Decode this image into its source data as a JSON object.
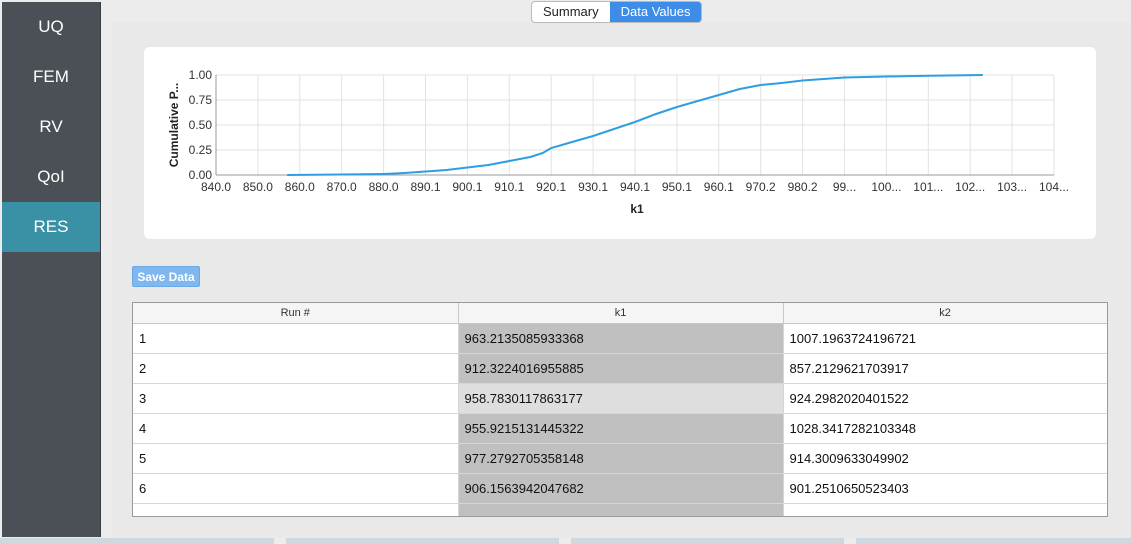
{
  "sidebar": {
    "items": [
      {
        "label": "UQ",
        "active": false
      },
      {
        "label": "FEM",
        "active": false
      },
      {
        "label": "RV",
        "active": false
      },
      {
        "label": "QoI",
        "active": false
      },
      {
        "label": "RES",
        "active": true
      }
    ]
  },
  "tabs": [
    {
      "label": "Summary",
      "active": false
    },
    {
      "label": "Data Values",
      "active": true
    }
  ],
  "chart_data": {
    "type": "line",
    "xlabel": "k1",
    "ylabel": "Cumulative P...",
    "xlim": [
      840.0,
      1040.0
    ],
    "ylim": [
      0.0,
      1.0
    ],
    "grid": true,
    "color": "#2f9ee0",
    "xticks": [
      "840.0",
      "850.0",
      "860.0",
      "870.0",
      "880.0",
      "890.1",
      "900.1",
      "910.1",
      "920.1",
      "930.1",
      "940.1",
      "950.1",
      "960.1",
      "970.2",
      "980.2",
      "99...",
      "100...",
      "101...",
      "102...",
      "103...",
      "104..."
    ],
    "yticks": [
      "0.00",
      "0.25",
      "0.50",
      "0.75",
      "1.00"
    ],
    "x": [
      857.0,
      870.0,
      880.0,
      885.0,
      890.0,
      895.0,
      900.0,
      905.0,
      910.0,
      915.0,
      918.0,
      920.0,
      925.0,
      930.0,
      935.0,
      940.0,
      945.0,
      950.0,
      955.0,
      960.0,
      965.0,
      970.0,
      975.0,
      980.0,
      985.0,
      990.0,
      1000.0,
      1010.0,
      1023.0
    ],
    "y": [
      0.0,
      0.005,
      0.01,
      0.02,
      0.035,
      0.05,
      0.075,
      0.1,
      0.14,
      0.18,
      0.22,
      0.27,
      0.33,
      0.39,
      0.46,
      0.53,
      0.61,
      0.68,
      0.74,
      0.8,
      0.86,
      0.9,
      0.92,
      0.945,
      0.96,
      0.975,
      0.985,
      0.993,
      1.0
    ]
  },
  "save_button": {
    "label": "Save Data"
  },
  "table": {
    "columns": [
      "Run #",
      "k1",
      "k2"
    ],
    "rows": [
      [
        "1",
        "963.2135085933368",
        "1007.1963724196721"
      ],
      [
        "2",
        "912.3224016955885",
        "857.2129621703917"
      ],
      [
        "3",
        "958.7830117863177",
        "924.2982020401522"
      ],
      [
        "4",
        "955.9215131445322",
        "1028.3417282103348"
      ],
      [
        "5",
        "977.2792705358148",
        "914.3009633049902"
      ],
      [
        "6",
        "906.1563942047682",
        "901.2510650523403"
      ]
    ]
  }
}
